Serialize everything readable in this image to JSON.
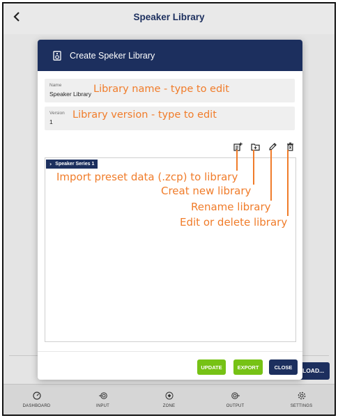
{
  "app": {
    "title": "Speaker Library",
    "back_icon": "chevron-left-icon"
  },
  "background": {
    "load_button_label": "LOAD..."
  },
  "modal": {
    "title": "Create Speker Library",
    "icon": "speaker-icon",
    "name_field": {
      "label": "Name",
      "value": "Speaker Library"
    },
    "version_field": {
      "label": "Version",
      "value": "1"
    },
    "toolbar": [
      {
        "name": "import-preset-icon"
      },
      {
        "name": "new-library-icon"
      },
      {
        "name": "rename-pencil-icon"
      },
      {
        "name": "delete-trash-icon"
      }
    ],
    "tree": {
      "items": [
        {
          "label": "Speaker Series 1",
          "expanded": false
        }
      ]
    },
    "buttons": {
      "update": "UPDATE",
      "export": "EXPORT",
      "close": "CLOSE"
    }
  },
  "bottom_nav": [
    {
      "label": "DASHBOARD",
      "icon": "dashboard-icon"
    },
    {
      "label": "INPUT",
      "icon": "input-icon"
    },
    {
      "label": "ZONE",
      "icon": "zone-icon"
    },
    {
      "label": "OUTPUT",
      "icon": "output-icon"
    },
    {
      "label": "SETTINGS",
      "icon": "settings-icon"
    }
  ],
  "annotations": {
    "name": "Library name - type to edit",
    "version": "Library version - type to edit",
    "import": "Import preset data (.zcp) to library",
    "create": "Creat new library",
    "rename": "Rename library",
    "edit": "Edit or delete library"
  },
  "colors": {
    "navy": "#1c2f5e",
    "green": "#76c215",
    "annotation": "#f07c2a"
  }
}
